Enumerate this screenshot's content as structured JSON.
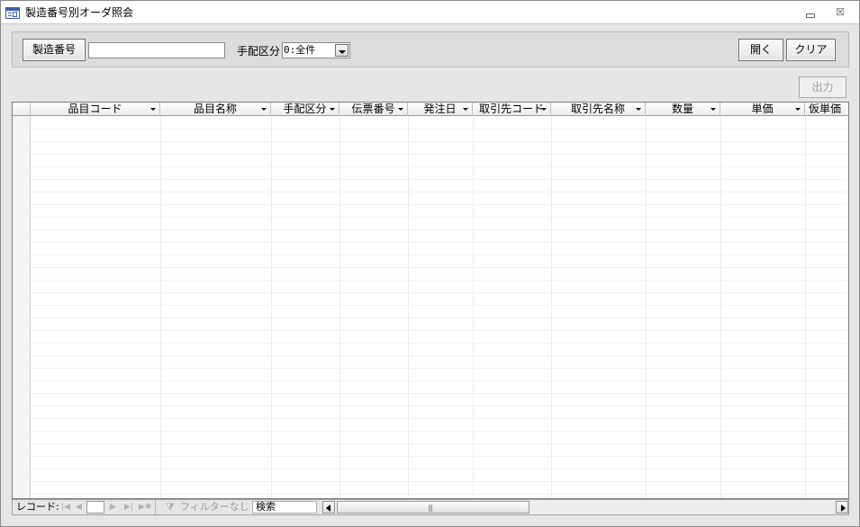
{
  "window": {
    "title": "製造番号別オーダ照会",
    "minimize_icon": "minimize-icon",
    "close_icon": "restore-close-icon"
  },
  "header": {
    "seizo_button_label": "製造番号",
    "seizo_input_value": "",
    "tehai_label": "手配区分",
    "tehai_value": "0:全件",
    "open_button_label": "開く",
    "clear_button_label": "クリア"
  },
  "output_button_label": "出力",
  "grid": {
    "columns": [
      "品目コード",
      "品目名称",
      "手配区分",
      "伝票番号",
      "発注日",
      "取引先コード",
      "取引先名称",
      "数量",
      "単価",
      "仮単価"
    ],
    "rows": []
  },
  "navbar": {
    "record_label": "レコード:",
    "position_value": "",
    "filter_label": "フィルターなし",
    "search_label": "検索"
  },
  "colors": {
    "window_bg": "#e6e6e6",
    "grid_bg": "#ffffff",
    "disabled_text": "#a0a0a0"
  }
}
